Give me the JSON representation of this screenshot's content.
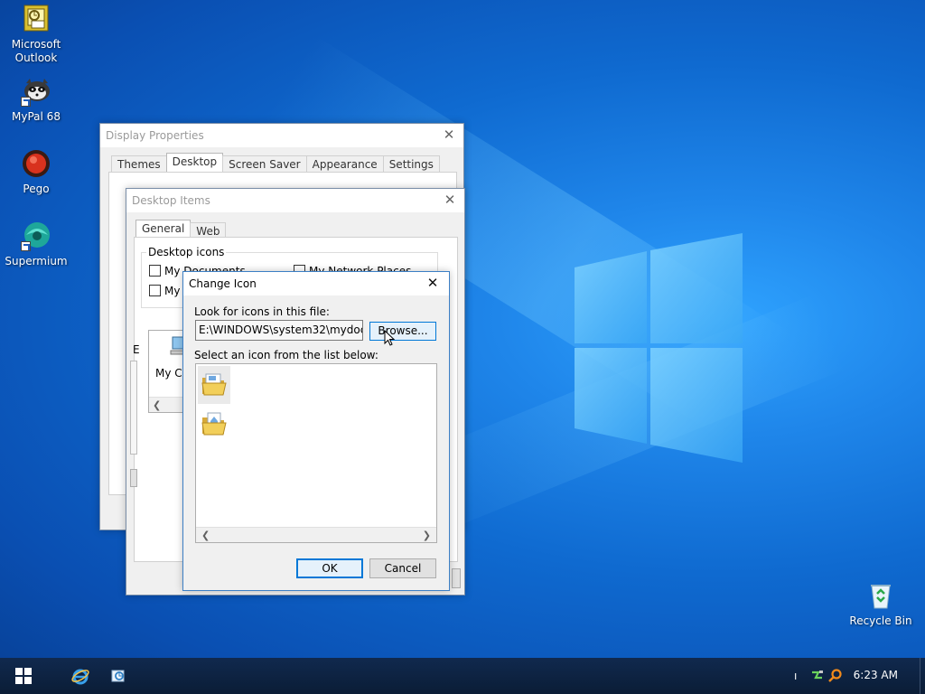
{
  "desktop": {
    "icons": [
      {
        "label": "Microsoft\nOutlook",
        "name": "outlook-icon"
      },
      {
        "label": "MyPal 68",
        "name": "mypal-icon"
      },
      {
        "label": "Pego",
        "name": "pego-icon"
      },
      {
        "label": "Supermium",
        "name": "supermium-icon"
      },
      {
        "label": "Recycle Bin",
        "name": "recycle-bin-icon"
      }
    ]
  },
  "display_properties": {
    "title": "Display Properties",
    "tabs": [
      "Themes",
      "Desktop",
      "Screen Saver",
      "Appearance",
      "Settings"
    ],
    "selected_tab": "Desktop"
  },
  "desktop_items": {
    "title": "Desktop Items",
    "tabs": [
      "General",
      "Web"
    ],
    "group_label": "Desktop icons",
    "checkboxes": [
      {
        "label": "My Documents",
        "checked": false
      },
      {
        "label": "My Network Places",
        "checked": false
      },
      {
        "label": "My",
        "checked": false
      }
    ],
    "partial_label_left": "E",
    "preview_label": "My Co"
  },
  "change_icon": {
    "title": "Change Icon",
    "look_label": "Look for icons in this file:",
    "file_path": "E:\\WINDOWS\\system32\\mydocs.dll",
    "browse_label": "Browse...",
    "select_label": "Select an icon from the list below:",
    "icons": [
      "folder-documents-icon",
      "folder-home-icon"
    ],
    "ok_label": "OK",
    "cancel_label": "Cancel"
  },
  "taskbar": {
    "clock": "6:23 AM",
    "tray_marker": "ı",
    "pinned": [
      "internet-explorer-icon",
      "outlook-express-icon"
    ]
  },
  "colors": {
    "accent": "#0078d7",
    "taskbar": "#0b1d36"
  }
}
